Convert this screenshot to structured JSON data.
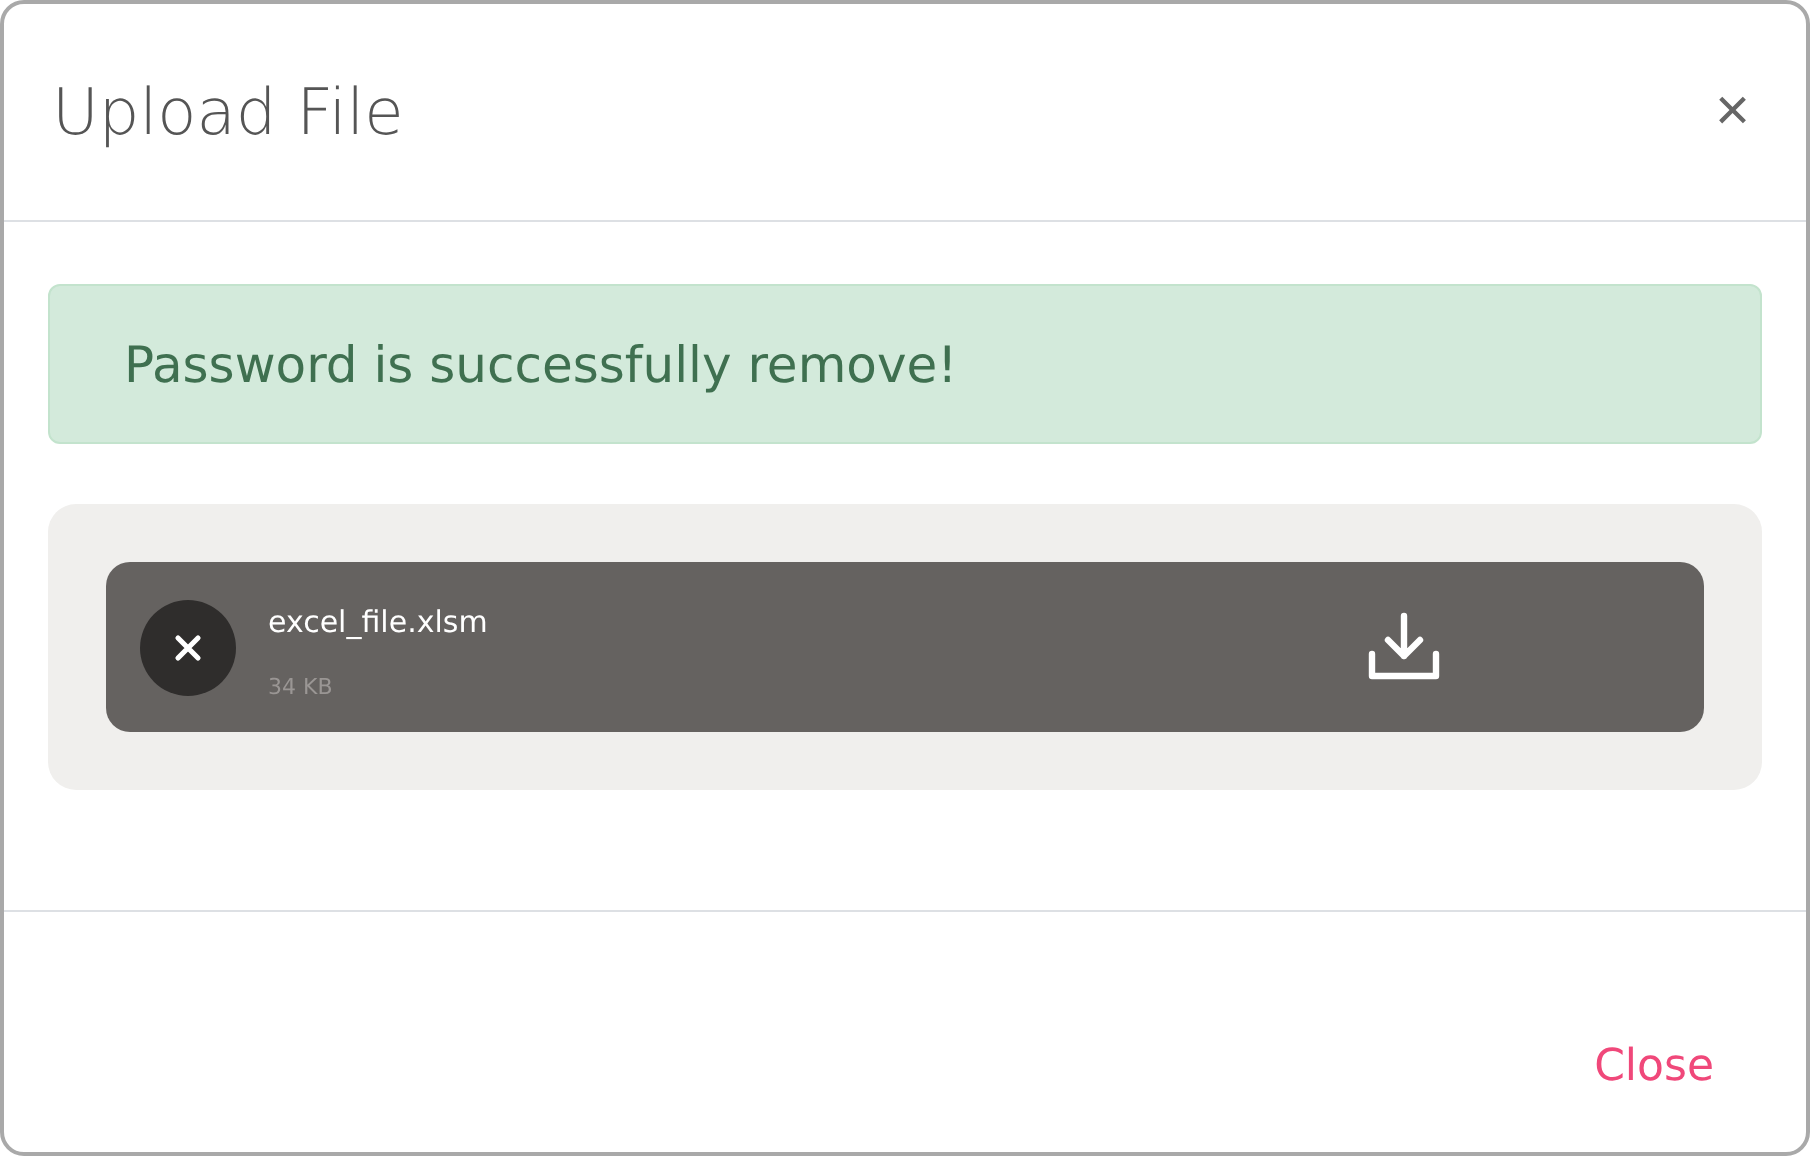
{
  "dialog": {
    "title": "Upload File",
    "close_glyph": "×"
  },
  "alert": {
    "kind": "success",
    "message": "Password is successfully remove!"
  },
  "files": [
    {
      "name": "excel_file.xlsm",
      "size": "34 KB"
    }
  ],
  "footer": {
    "close_label": "Close"
  }
}
